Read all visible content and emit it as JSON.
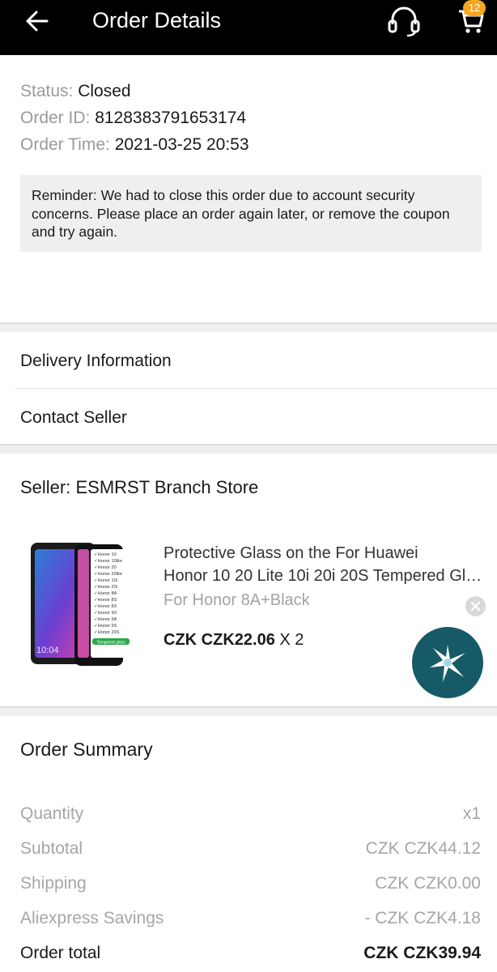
{
  "header": {
    "title": "Order Details",
    "back_icon": "arrow-left-icon",
    "support_icon": "headset-icon",
    "cart_icon": "shopping-cart-icon",
    "cart_count": "12",
    "background": "#000000",
    "badge_color": "#f5a623"
  },
  "order": {
    "status_label": "Status:",
    "status_value": "Closed",
    "id_label": "Order ID:",
    "id_value": "8128383791653174",
    "time_label": "Order Time:",
    "time_value": "2021-03-25 20:53",
    "reminder": "Reminder: We had to close this order due to account security concerns. Please place an order again later, or remove the coupon and try again."
  },
  "menu": {
    "delivery_label": "Delivery Information",
    "contact_label": "Contact Seller"
  },
  "seller": {
    "label": "Seller: ESMRST Branch Store"
  },
  "product": {
    "title_line1": "Protective Glass on the For Huawei",
    "title_line2": "Honor 10 20 Lite 10i 20i 20S Tempered Glass",
    "variant": "For Honor 8A+Black",
    "price": "CZK CZK22.06",
    "quantity": "X 2",
    "thumb_clock": "10:04",
    "thumb_models": [
      "Honor 10",
      "Honor 10lite",
      "Honor 20",
      "Honor 20lite",
      "Honor 10i",
      "Honor 20i",
      "Honor 8A",
      "Honor 8S",
      "Honor 8X",
      "Honor 9X",
      "Honor 9A",
      "Honor 9S",
      "Honor 20S"
    ],
    "thumb_tag": "Tempered glass"
  },
  "floating": {
    "close_icon": "close-icon",
    "fab_icon": "sparkle-burst-icon",
    "fab_color": "#165a68"
  },
  "summary": {
    "title": "Order Summary",
    "rows": [
      {
        "label": "Quantity",
        "value": "x1"
      },
      {
        "label": "Subtotal",
        "value": "CZK CZK44.12"
      },
      {
        "label": "Shipping",
        "value": "CZK CZK0.00"
      },
      {
        "label": "Aliexpress Savings",
        "value": "- CZK CZK4.18"
      },
      {
        "label": "Order total",
        "value": "CZK CZK39.94"
      }
    ]
  }
}
